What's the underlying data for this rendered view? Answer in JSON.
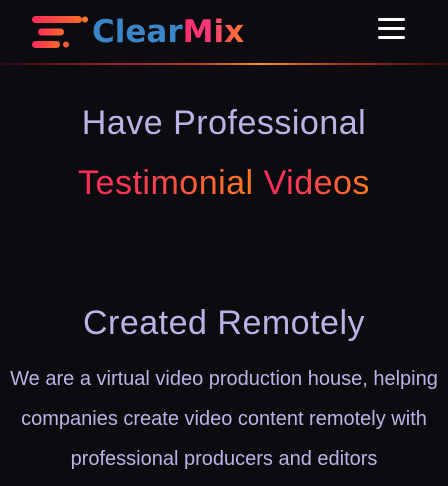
{
  "header": {
    "logo_text_part1": "Clear",
    "logo_text_part2": "Mix",
    "logo_icon": "speed-lines-icon",
    "menu_icon": "hamburger-menu-icon"
  },
  "hero": {
    "line1": "Have Professional",
    "line2_word1": "Testimonial",
    "line2_word2": "Videos",
    "subtitle": "Created Remotely",
    "description": "We are a virtual video production house, helping companies create video content remotely with professional producers and editors"
  },
  "colors": {
    "background": "#0b0b10",
    "text_lavender": "#b8b4e6",
    "brand_blue": "#3a86c8",
    "brand_pink": "#ff2e6e",
    "brand_orange": "#ff7a1f"
  }
}
